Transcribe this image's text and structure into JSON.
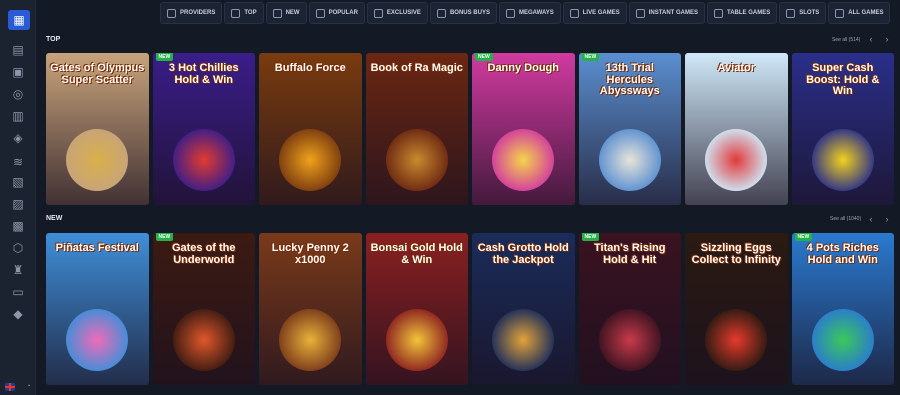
{
  "nav": {
    "categories": [
      {
        "label": "Providers",
        "icon": "providers-icon"
      },
      {
        "label": "Top",
        "icon": "crown-icon"
      },
      {
        "label": "New",
        "icon": "lightning-icon"
      },
      {
        "label": "Popular",
        "icon": "fire-icon"
      },
      {
        "label": "Exclusive",
        "icon": "diamond-icon"
      },
      {
        "label": "Bonus Buys",
        "icon": "cart-icon"
      },
      {
        "label": "Megaways",
        "icon": "megaways-icon"
      },
      {
        "label": "Live Games",
        "icon": "live-icon"
      },
      {
        "label": "Instant Games",
        "icon": "gamepad-icon"
      },
      {
        "label": "Table Games",
        "icon": "cards-icon"
      },
      {
        "label": "Slots",
        "icon": "slot-icon"
      },
      {
        "label": "All Games",
        "icon": "grid-icon"
      }
    ]
  },
  "sections": {
    "top": {
      "title": "Top",
      "see_all": "See all (514)",
      "games": [
        {
          "name": "Gates of Olympus Super Scatter",
          "badge": "",
          "bg": "#c7a37a",
          "accent": "#d8b04a"
        },
        {
          "name": "3 Hot Chillies Hold & Win",
          "badge": "NEW",
          "bg": "#3a1d8a",
          "accent": "#e23a2f"
        },
        {
          "name": "Buffalo Force",
          "badge": "",
          "bg": "#7a3b0f",
          "accent": "#f0a21c"
        },
        {
          "name": "Book of Ra Magic",
          "badge": "",
          "bg": "#6b2712",
          "accent": "#c98a2e"
        },
        {
          "name": "Danny Dough",
          "badge": "NEW",
          "bg": "#d13aa0",
          "accent": "#f6d44a"
        },
        {
          "name": "13th Trial Hercules Abyssways",
          "badge": "NEW",
          "bg": "#5a8fd0",
          "accent": "#e8e4da"
        },
        {
          "name": "Aviator",
          "badge": "",
          "bg": "#cfe8f8",
          "accent": "#e23a3a"
        },
        {
          "name": "Super Cash Boost: Hold & Win",
          "badge": "",
          "bg": "#2a2f8a",
          "accent": "#f3d21c"
        }
      ]
    },
    "new": {
      "title": "New",
      "see_all": "See all (1040)",
      "games": [
        {
          "name": "Piñatas Festival",
          "badge": "",
          "bg": "#3f8ed8",
          "accent": "#ef6bb8"
        },
        {
          "name": "Gates of the Underworld",
          "badge": "NEW",
          "bg": "#3c1a12",
          "accent": "#e0582a"
        },
        {
          "name": "Lucky Penny 2 x1000",
          "badge": "",
          "bg": "#7a3a1a",
          "accent": "#e8b23a"
        },
        {
          "name": "Bonsai Gold Hold & Win",
          "badge": "",
          "bg": "#8a2020",
          "accent": "#f3c43a"
        },
        {
          "name": "Cash Grotto Hold the Jackpot",
          "badge": "",
          "bg": "#1a2c5a",
          "accent": "#e3a33a"
        },
        {
          "name": "Titan's Rising Hold & Hit",
          "badge": "NEW",
          "bg": "#3a1220",
          "accent": "#c83a4a"
        },
        {
          "name": "Sizzling Eggs Collect to Infinity",
          "badge": "",
          "bg": "#2a1a12",
          "accent": "#e63a2a"
        },
        {
          "name": "4 Pots Riches Hold and Win",
          "badge": "NEW",
          "bg": "#2a7ad0",
          "accent": "#3ac85a"
        }
      ]
    }
  }
}
